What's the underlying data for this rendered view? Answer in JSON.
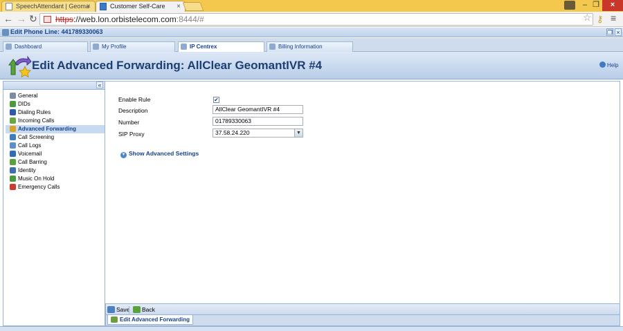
{
  "browser": {
    "tabs": [
      {
        "label": "SpeechAttendant | Geoma",
        "active": false
      },
      {
        "label": "Customer Self-Care",
        "active": true
      }
    ],
    "url": {
      "scheme": "https",
      "host": "://web.lon.orbistelecom.com",
      "rest": ":8444/#"
    }
  },
  "app": {
    "window_title": "Edit Phone Line: 441789330063",
    "tabs": [
      {
        "label": "Dashboard",
        "active": false
      },
      {
        "label": "My Profile",
        "active": false
      },
      {
        "label": "IP Centrex",
        "active": true
      },
      {
        "label": "Billing Information",
        "active": false
      }
    ],
    "page_title": "Edit Advanced Forwarding: AllClear GeomantIVR #4",
    "help_label": "Help",
    "collapse_glyph": "«"
  },
  "sidebar": {
    "items": [
      {
        "label": "General",
        "icon": "gear-icon",
        "color": "#7b8da3"
      },
      {
        "label": "DIDs",
        "icon": "did-icon",
        "color": "#4c9b3a"
      },
      {
        "label": "Dialing Rules",
        "icon": "dialing-rules-icon",
        "color": "#2d5aa6"
      },
      {
        "label": "Incoming Calls",
        "icon": "incoming-calls-icon",
        "color": "#6aa743"
      },
      {
        "label": "Advanced Forwarding",
        "icon": "forwarding-icon",
        "color": "#d6a526"
      },
      {
        "label": "Call Screening",
        "icon": "call-screening-icon",
        "color": "#3a7ec0"
      },
      {
        "label": "Call Logs",
        "icon": "call-logs-icon",
        "color": "#5b8fc7"
      },
      {
        "label": "Voicemail",
        "icon": "voicemail-icon",
        "color": "#2f6fb3"
      },
      {
        "label": "Call Barring",
        "icon": "call-barring-icon",
        "color": "#5aa33a"
      },
      {
        "label": "Identity",
        "icon": "identity-icon",
        "color": "#3c6fb0"
      },
      {
        "label": "Music On Hold",
        "icon": "music-icon",
        "color": "#4c9b3a"
      },
      {
        "label": "Emergency Calls",
        "icon": "emergency-icon",
        "color": "#c93c2f"
      }
    ],
    "active_index": 4
  },
  "form": {
    "enable_rule_label": "Enable Rule",
    "enable_rule_checked": true,
    "checkmark": "✔",
    "description_label": "Description",
    "description_value": "AllClear GeomantIVR #4",
    "number_label": "Number",
    "number_value": "01789330063",
    "sip_proxy_label": "SIP Proxy",
    "sip_proxy_value": "37.58.24.220",
    "advanced_toggle_label": "Show Advanced Settings"
  },
  "toolbar": {
    "save_label": "Save",
    "back_label": "Back"
  },
  "bottom_tab": {
    "label": "Edit Advanced Forwarding"
  }
}
